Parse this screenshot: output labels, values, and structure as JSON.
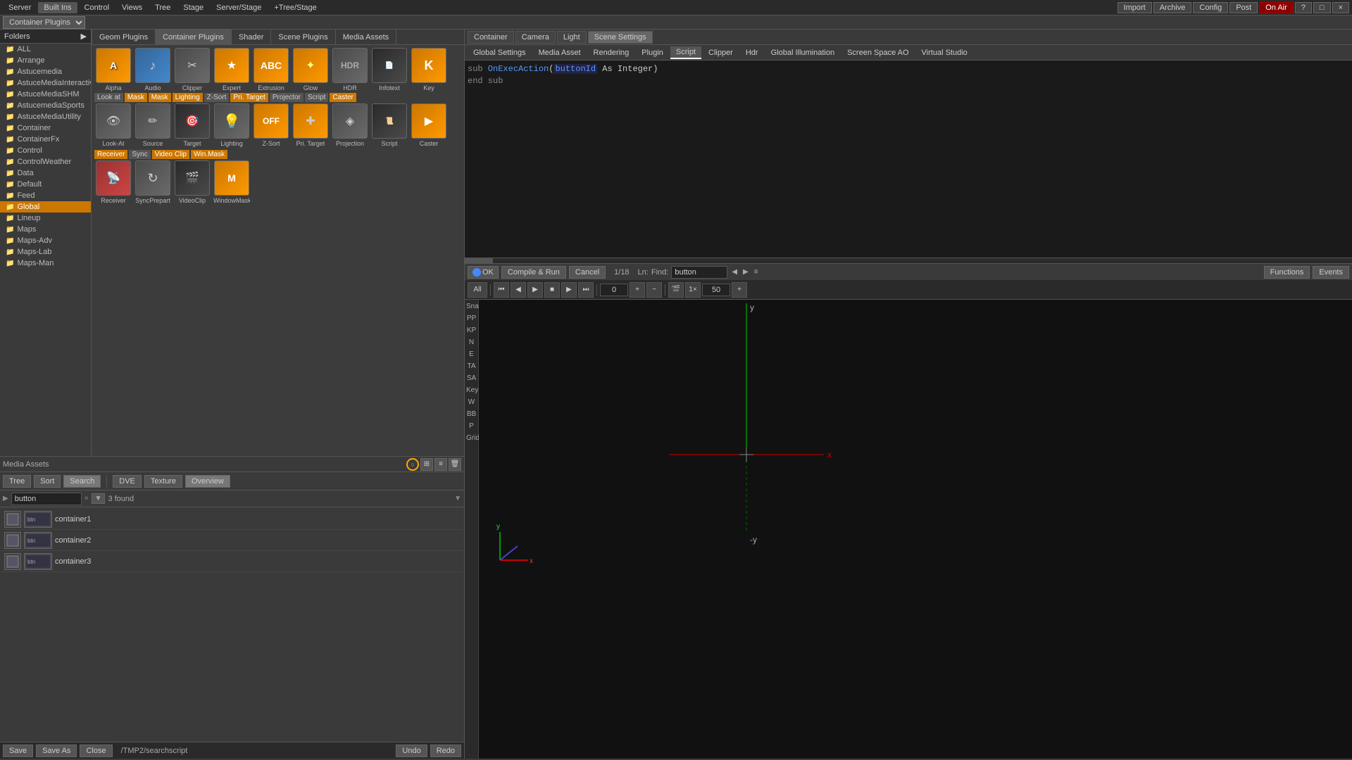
{
  "topbar": {
    "items": [
      "Server",
      "Built Ins",
      "Control",
      "Views",
      "Tree",
      "Stage",
      "Server/Stage",
      "+Tree/Stage"
    ],
    "right_items": [
      "Import",
      "Archive",
      "Config",
      "Post",
      "On Air"
    ],
    "icons": [
      "?",
      "□",
      "×",
      "−"
    ]
  },
  "container_bar": {
    "label": "Container Plugins",
    "dropdown_value": "Container Plugins"
  },
  "right_panel_tabs": {
    "main": [
      "Container",
      "Camera",
      "Light",
      "Scene Settings"
    ],
    "sub": [
      "Global Settings",
      "Media Asset",
      "Rendering",
      "Plugin",
      "Script",
      "Clipper",
      "Hdr",
      "Global Illumination",
      "Screen Space AO",
      "Virtual Studio"
    ]
  },
  "script_editor": {
    "line1": "sub OnExecAction(buttonId As Integer)",
    "line2": "end sub",
    "keyword_sub": "sub",
    "keyword_end": "end sub"
  },
  "editor_footer": {
    "ok_label": "OK",
    "compile_label": "Compile & Run",
    "cancel_label": "Cancel",
    "position": "1/18",
    "ln_label": "Ln:",
    "find_label": "Find:",
    "find_value": "button",
    "functions_label": "Functions",
    "events_label": "Events"
  },
  "plugin_tabs": [
    "Geom Plugins",
    "Container Plugins",
    "Shader",
    "Scene Plugins",
    "Media Assets"
  ],
  "plugins": {
    "row1": [
      {
        "label": "Alpha",
        "color": "orange"
      },
      {
        "label": "Audio",
        "color": "blue"
      },
      {
        "label": "Clipper",
        "color": "gray"
      },
      {
        "label": "Expert",
        "color": "orange"
      },
      {
        "label": "Extrusion",
        "color": "orange"
      },
      {
        "label": "Glow",
        "color": "orange"
      },
      {
        "label": "HDR",
        "color": "gray"
      },
      {
        "label": "Infotext",
        "color": "gray"
      },
      {
        "label": "Key",
        "color": "orange"
      }
    ],
    "row2": [
      {
        "label": "Look-At",
        "color": "gray"
      },
      {
        "label": "Source",
        "color": "gray"
      },
      {
        "label": "Target",
        "color": "gray"
      },
      {
        "label": "Lighting",
        "color": "gray"
      },
      {
        "label": "Z-Sort",
        "color": "orange"
      },
      {
        "label": "Pri. Target",
        "color": "orange"
      },
      {
        "label": "Projection",
        "color": "gray"
      },
      {
        "label": "Script",
        "color": "gray"
      },
      {
        "label": "Caster",
        "color": "orange"
      }
    ],
    "row3": [
      {
        "label": "Receiver",
        "color": "orange"
      },
      {
        "label": "SyncPrepart",
        "color": "gray"
      },
      {
        "label": "VideoClip",
        "color": "gray"
      },
      {
        "label": "WindowMask",
        "color": "orange"
      }
    ]
  },
  "folders": {
    "title": "Folders",
    "items": [
      {
        "label": "ALL",
        "active": false
      },
      {
        "label": "Arrange",
        "active": false
      },
      {
        "label": "Astucemedia",
        "active": false
      },
      {
        "label": "AstuceMediaInteractive",
        "active": false
      },
      {
        "label": "AstuceMediaSHM",
        "active": false
      },
      {
        "label": "AstucemediaSports",
        "active": false
      },
      {
        "label": "AstuceMediaUtility",
        "active": false
      },
      {
        "label": "Container",
        "active": false
      },
      {
        "label": "ContainerFx",
        "active": false
      },
      {
        "label": "Control",
        "active": false
      },
      {
        "label": "ControlWeather",
        "active": false
      },
      {
        "label": "Data",
        "active": false
      },
      {
        "label": "Default",
        "active": false
      },
      {
        "label": "Feed",
        "active": false
      },
      {
        "label": "Global",
        "active": true
      },
      {
        "label": "Lineup",
        "active": false
      },
      {
        "label": "Maps",
        "active": false
      },
      {
        "label": "Maps-Adv",
        "active": false
      },
      {
        "label": "Maps-Lab",
        "active": false
      },
      {
        "label": "Maps-Man",
        "active": false
      }
    ]
  },
  "media_assets": {
    "tabs": [
      "DVE",
      "Texture",
      "Overview"
    ],
    "tree_tabs": [
      "Tree",
      "Sort",
      "Search"
    ],
    "search_placeholder": "button",
    "found_count": "3 found",
    "files": [
      {
        "name": "container1"
      },
      {
        "name": "container2"
      },
      {
        "name": "container3"
      }
    ]
  },
  "bottom_bar": {
    "save": "Save",
    "save_as": "Save As",
    "close": "Close",
    "path": "/TMP2/searchscript",
    "undo": "Undo",
    "redo": "Redo"
  },
  "viewport": {
    "side_labels": [
      "Snap",
      "PP",
      "KP",
      "N",
      "E",
      "TA",
      "SA",
      "Key",
      "W",
      "BB",
      "P",
      "Grid"
    ],
    "y_label_top": "y",
    "y_label_bottom": "-y",
    "x_label": "x"
  },
  "playback": {
    "all_label": "All",
    "frame_count": "50"
  }
}
